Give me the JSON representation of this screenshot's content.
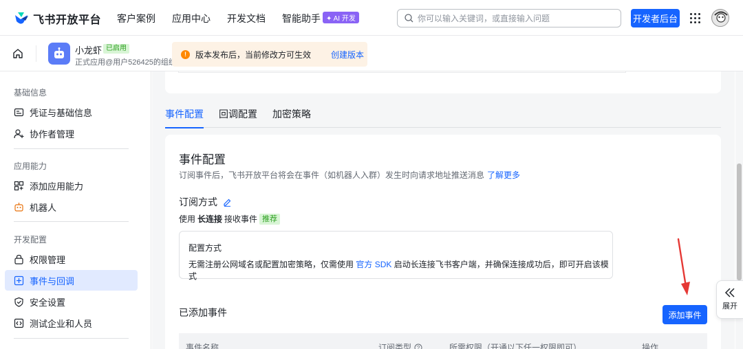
{
  "brand": {
    "name": "飞书开放平台"
  },
  "nav": {
    "links": [
      "客户案例",
      "应用中心",
      "开发文档",
      "智能助手"
    ],
    "ai_badge": "✦ AI 开发",
    "search_placeholder": "你可以输入关键词，或直接输入问题",
    "dev_console": "开发者后台"
  },
  "app": {
    "name": "小龙虾",
    "status": "已启用",
    "desc": "正式应用@用户526425的组织"
  },
  "notice": {
    "icon": "!",
    "text": "版本发布后，当前修改方可生效",
    "action": "创建版本"
  },
  "sidebar": {
    "groups": [
      "基础信息",
      "应用能力",
      "开发配置"
    ],
    "items": [
      {
        "label": "凭证与基础信息",
        "icon": "id-card-icon"
      },
      {
        "label": "协作者管理",
        "icon": "user-add-icon"
      },
      {
        "label": "添加应用能力",
        "icon": "apps-add-icon"
      },
      {
        "label": "机器人",
        "icon": "robot-icon"
      },
      {
        "label": "权限管理",
        "icon": "lock-icon"
      },
      {
        "label": "事件与回调",
        "icon": "event-icon"
      },
      {
        "label": "安全设置",
        "icon": "shield-icon"
      },
      {
        "label": "测试企业和人员",
        "icon": "code-icon"
      }
    ],
    "active_item": "事件与回调"
  },
  "tabs": [
    "事件配置",
    "回调配置",
    "加密策略"
  ],
  "active_tab": "事件配置",
  "event_config": {
    "title": "事件配置",
    "desc": "订阅事件后，飞书开放平台将会在事件（如机器人入群）发生时向请求地址推送消息",
    "learn_more": "了解更多",
    "subscribe_title": "订阅方式",
    "sub_prefix": "使用",
    "sub_mode": "长连接",
    "sub_suffix": "接收事件",
    "recommend": "推荐",
    "config_box": {
      "title": "配置方式",
      "desc_before": "无需注册公网域名或配置加密策略，仅需使用",
      "sdk_link": "官方 SDK",
      "desc_after": "启动长连接飞书客户端，并确保连接成功后，即可开启该模式"
    },
    "added_title": "已添加事件",
    "add_button": "添加事件",
    "table_headers": [
      "事件名称",
      "订阅类型",
      "所需权限（开通以下任一权限即可）",
      "操作"
    ]
  },
  "expand_label": "展开",
  "colors": {
    "primary": "#1664ff",
    "active_bg": "#e1eaff",
    "notice_bg": "#fdf2e5",
    "arrow": "#e53935"
  }
}
